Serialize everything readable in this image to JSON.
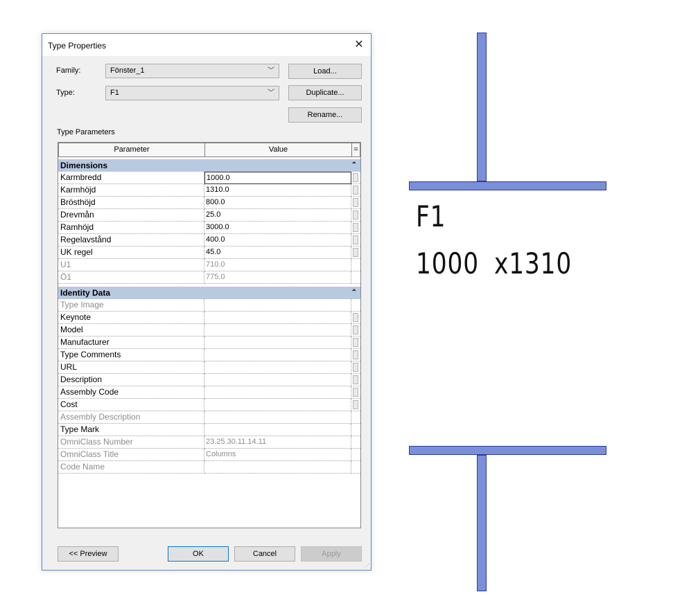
{
  "dialog": {
    "title": "Type Properties",
    "family_label": "Family:",
    "family_value": "Fönster_1",
    "type_label": "Type:",
    "type_value": "F1",
    "load_label": "Load...",
    "duplicate_label": "Duplicate...",
    "rename_label": "Rename...",
    "type_parameters_label": "Type Parameters",
    "col_parameter": "Parameter",
    "col_value": "Value",
    "col_eq": "=",
    "groups": [
      {
        "name": "Dimensions",
        "rows": [
          {
            "p": "Karmbredd",
            "v": "1000.0",
            "enabled": true
          },
          {
            "p": "Karmhöjd",
            "v": "1310.0",
            "enabled": true
          },
          {
            "p": "Brösthöjd",
            "v": "800.0",
            "enabled": true
          },
          {
            "p": "Drevmån",
            "v": "25.0",
            "enabled": true
          },
          {
            "p": "Ramhöjd",
            "v": "3000.0",
            "enabled": true
          },
          {
            "p": "Regelavstånd",
            "v": "400.0",
            "enabled": true
          },
          {
            "p": "UK regel",
            "v": "45.0",
            "enabled": true
          },
          {
            "p": "U1",
            "v": "710.0",
            "enabled": false
          },
          {
            "p": "Ö1",
            "v": "775.0",
            "enabled": false
          }
        ]
      },
      {
        "name": "Identity Data",
        "rows": [
          {
            "p": "Type Image",
            "v": "",
            "enabled": false
          },
          {
            "p": "Keynote",
            "v": "",
            "enabled": true
          },
          {
            "p": "Model",
            "v": "",
            "enabled": true
          },
          {
            "p": "Manufacturer",
            "v": "",
            "enabled": true
          },
          {
            "p": "Type Comments",
            "v": "",
            "enabled": true
          },
          {
            "p": "URL",
            "v": "",
            "enabled": true
          },
          {
            "p": "Description",
            "v": "",
            "enabled": true
          },
          {
            "p": "Assembly Code",
            "v": "",
            "enabled": true
          },
          {
            "p": "Cost",
            "v": "",
            "enabled": true
          },
          {
            "p": "Assembly Description",
            "v": "",
            "enabled": false
          },
          {
            "p": "Type Mark",
            "v": "",
            "enabled": true
          },
          {
            "p": "OmniClass Number",
            "v": "23.25.30.11.14.11",
            "enabled": false
          },
          {
            "p": "OmniClass Title",
            "v": "Columns",
            "enabled": false
          },
          {
            "p": "Code Name",
            "v": "",
            "enabled": false
          }
        ]
      }
    ],
    "preview_label": "<< Preview",
    "ok_label": "OK",
    "cancel_label": "Cancel",
    "apply_label": "Apply"
  },
  "drawing": {
    "tag_name": "F1",
    "tag_size_w": "1000",
    "tag_size_h": "x1310",
    "wall_color": "#7b8fd8"
  }
}
